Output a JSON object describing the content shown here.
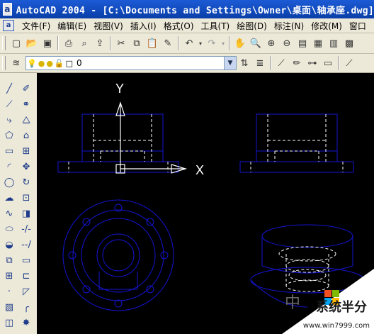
{
  "window": {
    "app_icon_letter": "a",
    "title": "AutoCAD 2004 - [C:\\Documents and Settings\\Owner\\桌面\\轴承座.dwg]"
  },
  "menubar": {
    "items": [
      "文件(F)",
      "编辑(E)",
      "视图(V)",
      "插入(I)",
      "格式(O)",
      "工具(T)",
      "绘图(D)",
      "标注(N)",
      "修改(M)",
      "窗口"
    ]
  },
  "layer_toolbar": {
    "current_layer": "0"
  },
  "drawing": {
    "ucs_y_label": "Y",
    "ucs_x_label": "X",
    "line_color": "#1414d2",
    "dash_color": "#ffffff",
    "background": "#000000"
  },
  "watermark": {
    "text": "系统半分",
    "url": "www.win7999.com",
    "side_text": "中"
  }
}
